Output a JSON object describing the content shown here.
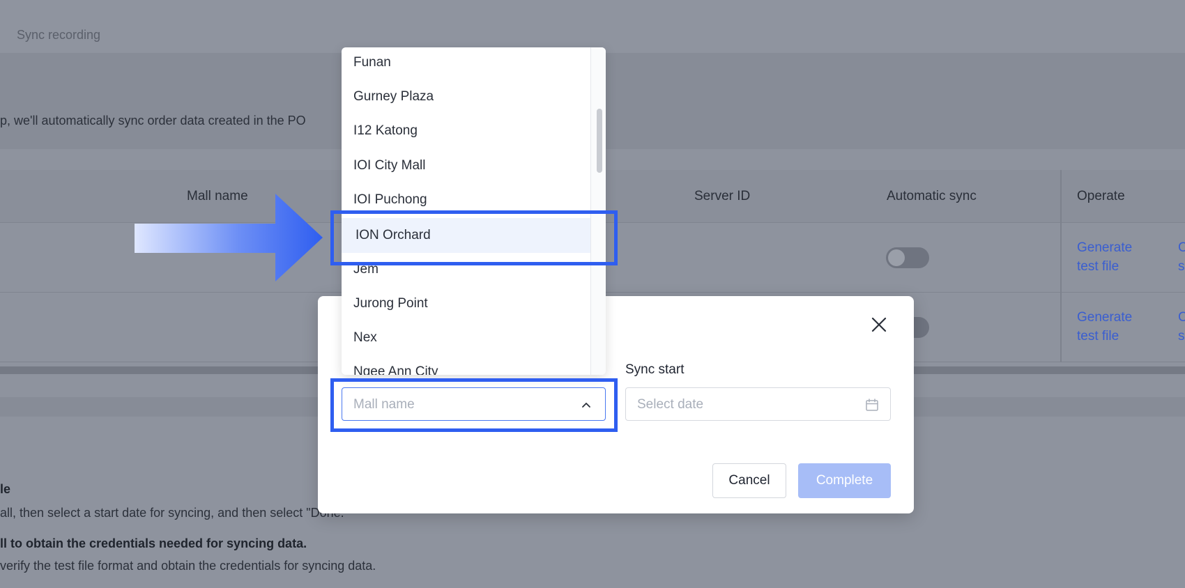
{
  "background": {
    "tab_label": "Sync recording",
    "description": "p, we'll automatically sync order data created in the PO",
    "table": {
      "headers": {
        "mall_name": "Mall name",
        "server_id": "Server ID",
        "automatic_sync": "Automatic sync",
        "operate": "Operate"
      },
      "rows": [
        {
          "generate_line1": "Generate",
          "generate_line2": "test file",
          "obtain_line1": "C",
          "obtain_line2": "s",
          "auto_sync": false
        },
        {
          "generate_line1": "Generate",
          "generate_line2": "test file",
          "obtain_line1": "C",
          "obtain_line2": "s",
          "auto_sync": false
        }
      ]
    },
    "guide": {
      "step1_title": "le",
      "step1_text": "all, then select a start date for syncing, and then select \"Done.\"",
      "step2_title": "ll to obtain the credentials needed for syncing data.",
      "step2_text": "verify the test file format and obtain the credentials for syncing data."
    }
  },
  "modal": {
    "sync_start_label": "Sync start",
    "mall_select_placeholder": "Mall name",
    "date_placeholder": "Select date",
    "cancel_label": "Cancel",
    "complete_label": "Complete"
  },
  "dropdown": {
    "selected": "ION Orchard",
    "options": [
      "Funan",
      "Gurney Plaza",
      "I12 Katong",
      "IOI City Mall",
      "IOI Puchong",
      "ION Orchard",
      "Jem",
      "Jurong Point",
      "Nex",
      "Ngee Ann City"
    ]
  },
  "colors": {
    "accent": "#2f5ef0",
    "link": "#3a5ed0",
    "complete_disabled": "#a7bdf7",
    "overlay": "#8e939e",
    "selected_option_bg": "#eef3fd"
  },
  "icons": {
    "close": "close-icon",
    "chevron": "chevron-up-icon",
    "calendar": "calendar-icon",
    "arrow": "arrow-right-icon"
  }
}
